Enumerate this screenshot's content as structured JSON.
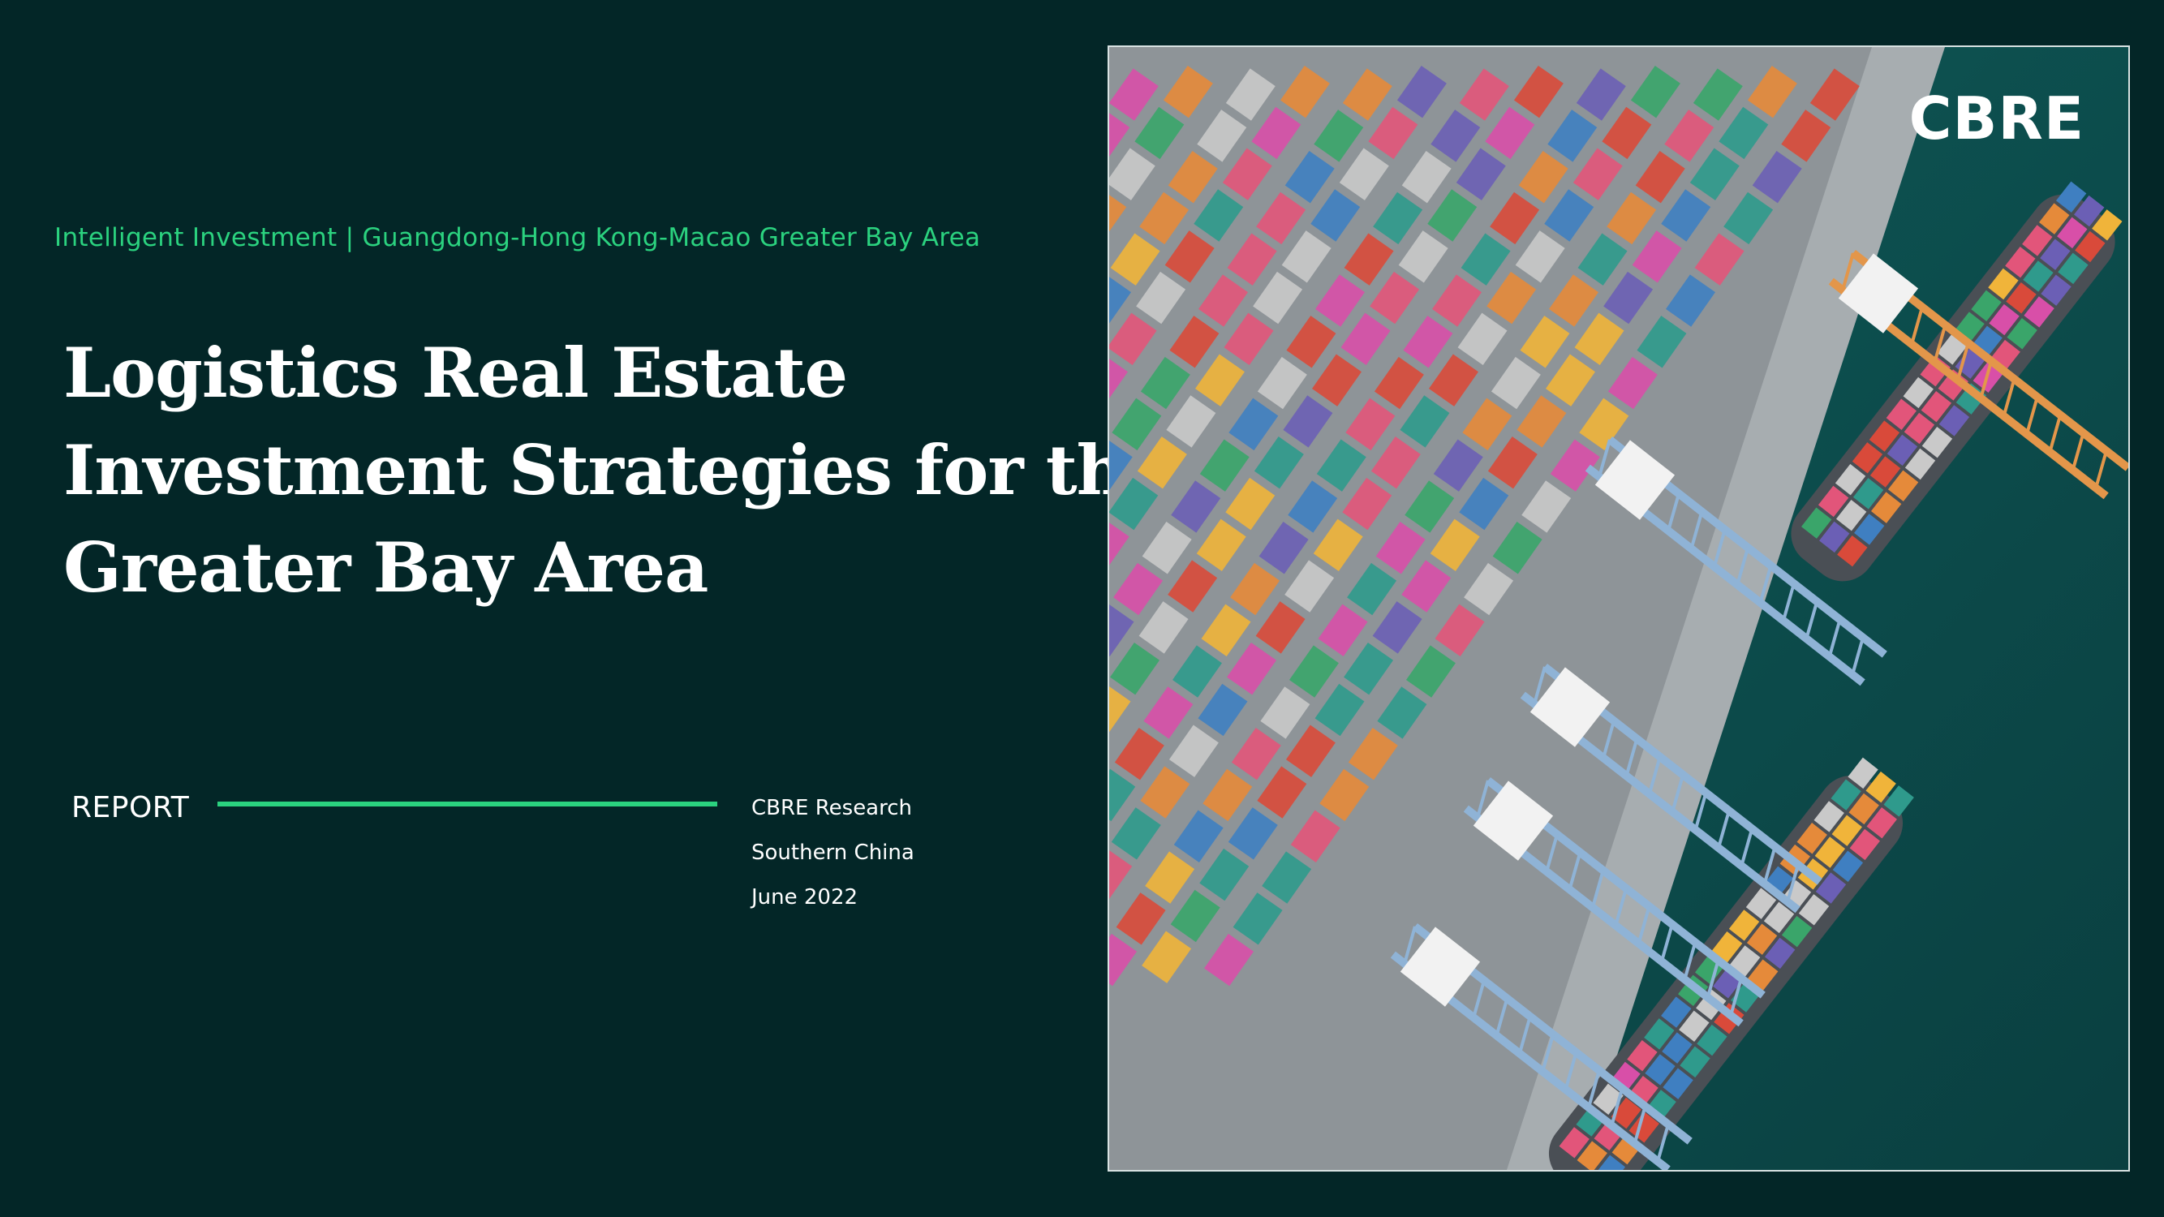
{
  "cover": {
    "subtitle": "Intelligent Investment | Guangdong-Hong Kong-Macao Greater Bay Area",
    "title_lines": [
      "Logistics Real Estate",
      "Investment Strategies for the",
      "Greater Bay Area"
    ],
    "report_label": "REPORT",
    "meta": [
      "CBRE Research",
      "Southern China",
      "June 2022"
    ]
  },
  "photo": {
    "brand_logo": "CBRE",
    "description_icon": "container-port-aerial-image"
  },
  "colors": {
    "background": "#032627",
    "accent": "#2bd27f",
    "text": "#ffffff"
  }
}
